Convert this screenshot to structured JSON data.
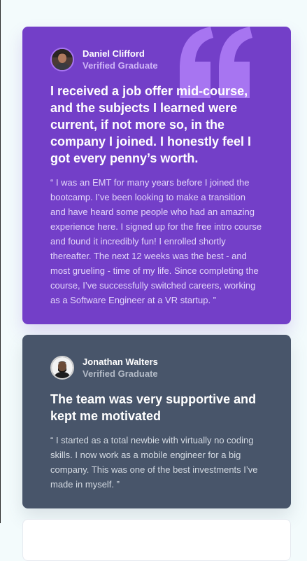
{
  "testimonials": [
    {
      "name": "Daniel Clifford",
      "role": "Verified Graduate",
      "headline": "I received a job offer mid-course, and the subjects I learned were current, if not more so, in the company I joined. I honestly feel I got every penny’s worth.",
      "quote": "“ I was an EMT for many years before I joined the bootcamp. I’ve been looking to make a transition and have heard some people who had an amazing experience here. I signed up for the free intro course and found it incredibly fun! I enrolled shortly thereafter. The next 12 weeks was the best - and most grueling - time of my life. Since completing the course, I’ve successfully switched careers, working as a Software Engineer at a VR startup. ”",
      "background": "#733fc8"
    },
    {
      "name": "Jonathan Walters",
      "role": "Verified Graduate",
      "headline": "The team was very supportive and kept me motivated",
      "quote": "“ I started as a total newbie with virtually no coding skills. I now work as a mobile engineer for a big company. This was one of the best investments I’ve made in myself. ”",
      "background": "#48556a"
    }
  ],
  "icons": {
    "quote": "quotation-mark-icon",
    "avatar": "avatar-photo"
  }
}
